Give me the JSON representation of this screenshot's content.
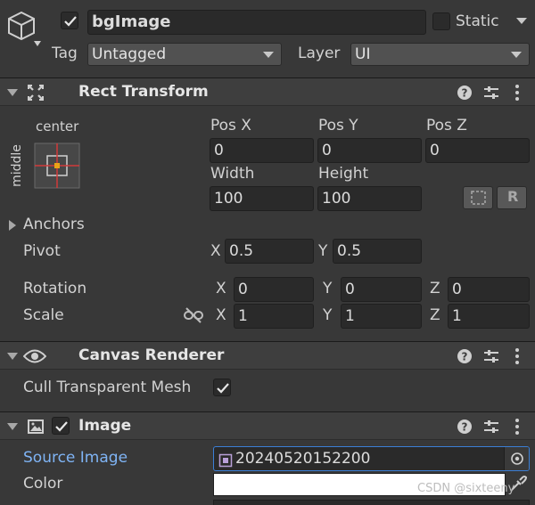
{
  "gameobject": {
    "active": true,
    "name": "bgImage",
    "static_label": "Static",
    "static_checked": false,
    "tag_label": "Tag",
    "tag_value": "Untagged",
    "layer_label": "Layer",
    "layer_value": "UI"
  },
  "rect_transform": {
    "title": "Rect Transform",
    "anchor_preset_h": "center",
    "anchor_preset_v": "middle",
    "pos_x_label": "Pos X",
    "pos_y_label": "Pos Y",
    "pos_z_label": "Pos Z",
    "pos_x": "0",
    "pos_y": "0",
    "pos_z": "0",
    "width_label": "Width",
    "height_label": "Height",
    "width": "100",
    "height": "100",
    "raw_edit_label": "R",
    "anchors_label": "Anchors",
    "pivot_label": "Pivot",
    "pivot_x": "0.5",
    "pivot_y": "0.5",
    "rotation_label": "Rotation",
    "rot_x": "0",
    "rot_y": "0",
    "rot_z": "0",
    "scale_label": "Scale",
    "scale_x": "1",
    "scale_y": "1",
    "scale_z": "1",
    "axis_x": "X",
    "axis_y": "Y",
    "axis_z": "Z"
  },
  "canvas_renderer": {
    "title": "Canvas Renderer",
    "cull_label": "Cull Transparent Mesh",
    "cull_checked": true
  },
  "image": {
    "title": "Image",
    "enabled": true,
    "source_image_label": "Source Image",
    "source_image_value": "20240520152200",
    "color_label": "Color",
    "color_value": "#ffffff"
  },
  "watermark": "CSDN @sixteeny"
}
